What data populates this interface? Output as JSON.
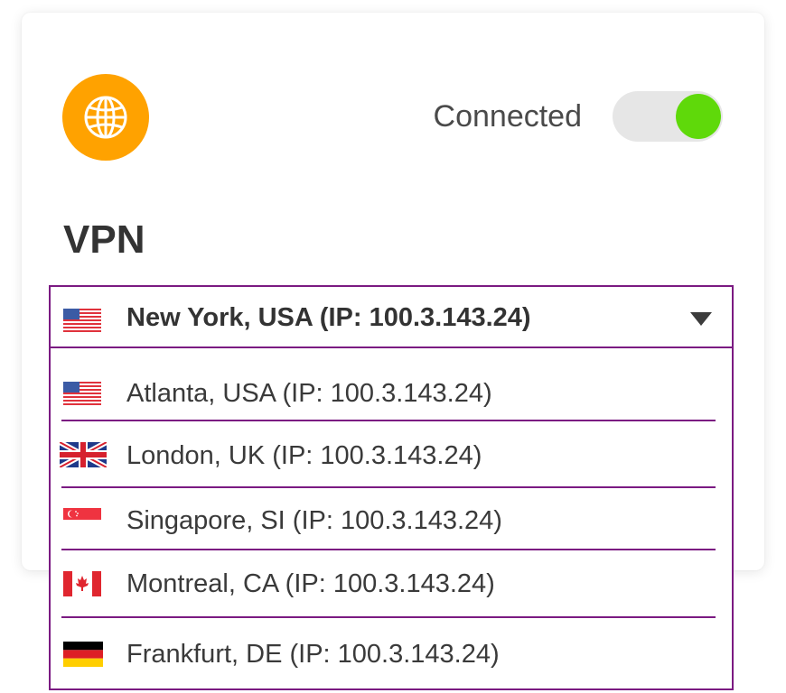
{
  "status": {
    "label": "Connected",
    "toggle_on": true,
    "toggle_color": "#5fd90a"
  },
  "app": {
    "icon": "globe-icon",
    "icon_bg": "#ffa200",
    "title": "VPN"
  },
  "selected": {
    "flag": "flag-us-icon",
    "label": "New York, USA (IP: 100.3.143.24)"
  },
  "options": [
    {
      "flag": "flag-us-icon",
      "label": "Atlanta, USA (IP: 100.3.143.24)"
    },
    {
      "flag": "flag-uk-icon",
      "label": "London, UK (IP: 100.3.143.24)"
    },
    {
      "flag": "flag-sg-icon",
      "label": "Singapore, SI (IP: 100.3.143.24)"
    },
    {
      "flag": "flag-ca-icon",
      "label": "Montreal, CA (IP: 100.3.143.24)"
    },
    {
      "flag": "flag-de-icon",
      "label": "Frankfurt, DE (IP: 100.3.143.24)"
    }
  ],
  "colors": {
    "accent_border": "#7b1a82",
    "text": "#333333"
  }
}
